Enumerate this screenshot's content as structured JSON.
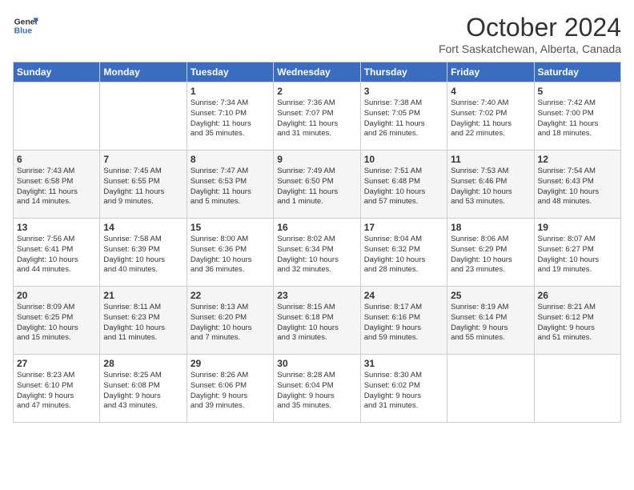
{
  "header": {
    "logo_line1": "General",
    "logo_line2": "Blue",
    "month": "October 2024",
    "location": "Fort Saskatchewan, Alberta, Canada"
  },
  "weekdays": [
    "Sunday",
    "Monday",
    "Tuesday",
    "Wednesday",
    "Thursday",
    "Friday",
    "Saturday"
  ],
  "rows": [
    [
      {
        "day": "",
        "content": ""
      },
      {
        "day": "",
        "content": ""
      },
      {
        "day": "1",
        "content": "Sunrise: 7:34 AM\nSunset: 7:10 PM\nDaylight: 11 hours\nand 35 minutes."
      },
      {
        "day": "2",
        "content": "Sunrise: 7:36 AM\nSunset: 7:07 PM\nDaylight: 11 hours\nand 31 minutes."
      },
      {
        "day": "3",
        "content": "Sunrise: 7:38 AM\nSunset: 7:05 PM\nDaylight: 11 hours\nand 26 minutes."
      },
      {
        "day": "4",
        "content": "Sunrise: 7:40 AM\nSunset: 7:02 PM\nDaylight: 11 hours\nand 22 minutes."
      },
      {
        "day": "5",
        "content": "Sunrise: 7:42 AM\nSunset: 7:00 PM\nDaylight: 11 hours\nand 18 minutes."
      }
    ],
    [
      {
        "day": "6",
        "content": "Sunrise: 7:43 AM\nSunset: 6:58 PM\nDaylight: 11 hours\nand 14 minutes."
      },
      {
        "day": "7",
        "content": "Sunrise: 7:45 AM\nSunset: 6:55 PM\nDaylight: 11 hours\nand 9 minutes."
      },
      {
        "day": "8",
        "content": "Sunrise: 7:47 AM\nSunset: 6:53 PM\nDaylight: 11 hours\nand 5 minutes."
      },
      {
        "day": "9",
        "content": "Sunrise: 7:49 AM\nSunset: 6:50 PM\nDaylight: 11 hours\nand 1 minute."
      },
      {
        "day": "10",
        "content": "Sunrise: 7:51 AM\nSunset: 6:48 PM\nDaylight: 10 hours\nand 57 minutes."
      },
      {
        "day": "11",
        "content": "Sunrise: 7:53 AM\nSunset: 6:46 PM\nDaylight: 10 hours\nand 53 minutes."
      },
      {
        "day": "12",
        "content": "Sunrise: 7:54 AM\nSunset: 6:43 PM\nDaylight: 10 hours\nand 48 minutes."
      }
    ],
    [
      {
        "day": "13",
        "content": "Sunrise: 7:56 AM\nSunset: 6:41 PM\nDaylight: 10 hours\nand 44 minutes."
      },
      {
        "day": "14",
        "content": "Sunrise: 7:58 AM\nSunset: 6:39 PM\nDaylight: 10 hours\nand 40 minutes."
      },
      {
        "day": "15",
        "content": "Sunrise: 8:00 AM\nSunset: 6:36 PM\nDaylight: 10 hours\nand 36 minutes."
      },
      {
        "day": "16",
        "content": "Sunrise: 8:02 AM\nSunset: 6:34 PM\nDaylight: 10 hours\nand 32 minutes."
      },
      {
        "day": "17",
        "content": "Sunrise: 8:04 AM\nSunset: 6:32 PM\nDaylight: 10 hours\nand 28 minutes."
      },
      {
        "day": "18",
        "content": "Sunrise: 8:06 AM\nSunset: 6:29 PM\nDaylight: 10 hours\nand 23 minutes."
      },
      {
        "day": "19",
        "content": "Sunrise: 8:07 AM\nSunset: 6:27 PM\nDaylight: 10 hours\nand 19 minutes."
      }
    ],
    [
      {
        "day": "20",
        "content": "Sunrise: 8:09 AM\nSunset: 6:25 PM\nDaylight: 10 hours\nand 15 minutes."
      },
      {
        "day": "21",
        "content": "Sunrise: 8:11 AM\nSunset: 6:23 PM\nDaylight: 10 hours\nand 11 minutes."
      },
      {
        "day": "22",
        "content": "Sunrise: 8:13 AM\nSunset: 6:20 PM\nDaylight: 10 hours\nand 7 minutes."
      },
      {
        "day": "23",
        "content": "Sunrise: 8:15 AM\nSunset: 6:18 PM\nDaylight: 10 hours\nand 3 minutes."
      },
      {
        "day": "24",
        "content": "Sunrise: 8:17 AM\nSunset: 6:16 PM\nDaylight: 9 hours\nand 59 minutes."
      },
      {
        "day": "25",
        "content": "Sunrise: 8:19 AM\nSunset: 6:14 PM\nDaylight: 9 hours\nand 55 minutes."
      },
      {
        "day": "26",
        "content": "Sunrise: 8:21 AM\nSunset: 6:12 PM\nDaylight: 9 hours\nand 51 minutes."
      }
    ],
    [
      {
        "day": "27",
        "content": "Sunrise: 8:23 AM\nSunset: 6:10 PM\nDaylight: 9 hours\nand 47 minutes."
      },
      {
        "day": "28",
        "content": "Sunrise: 8:25 AM\nSunset: 6:08 PM\nDaylight: 9 hours\nand 43 minutes."
      },
      {
        "day": "29",
        "content": "Sunrise: 8:26 AM\nSunset: 6:06 PM\nDaylight: 9 hours\nand 39 minutes."
      },
      {
        "day": "30",
        "content": "Sunrise: 8:28 AM\nSunset: 6:04 PM\nDaylight: 9 hours\nand 35 minutes."
      },
      {
        "day": "31",
        "content": "Sunrise: 8:30 AM\nSunset: 6:02 PM\nDaylight: 9 hours\nand 31 minutes."
      },
      {
        "day": "",
        "content": ""
      },
      {
        "day": "",
        "content": ""
      }
    ]
  ]
}
